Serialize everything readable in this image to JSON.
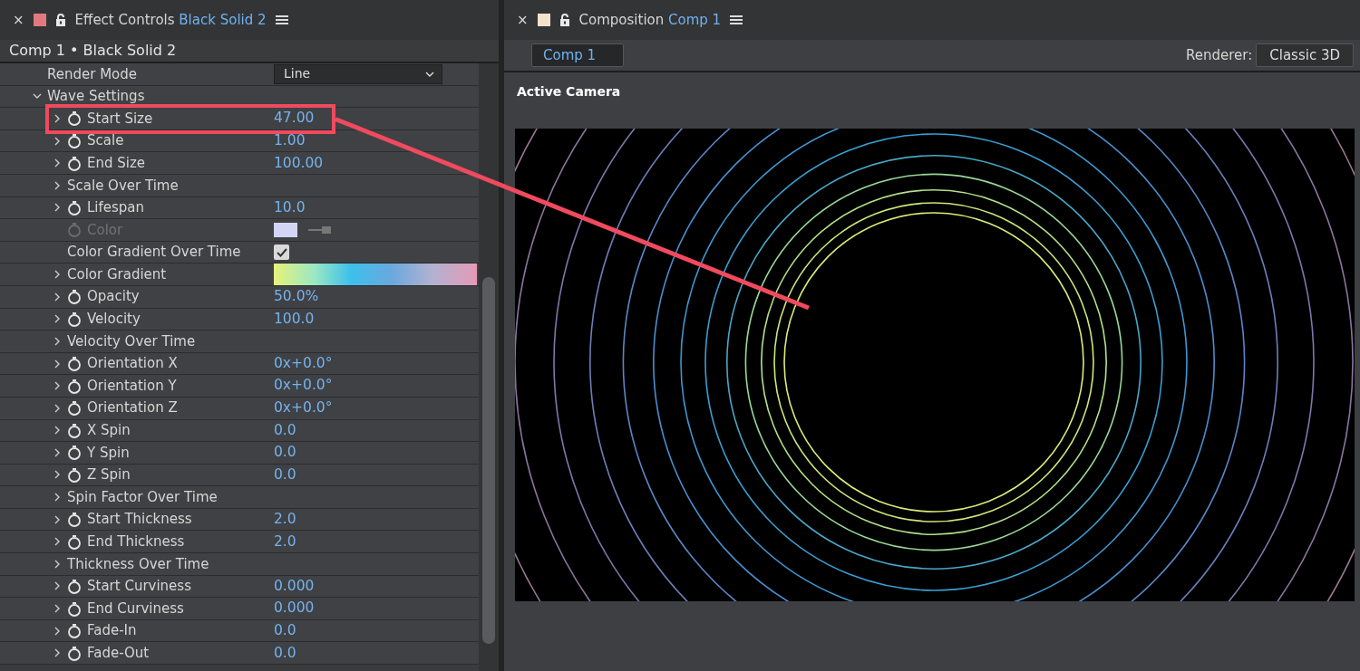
{
  "effect_panel": {
    "close": "×",
    "title": "Effect Controls",
    "layer": "Black Solid 2",
    "breadcrumb": "Comp 1 • Black Solid 2",
    "properties": [
      {
        "kind": "dropdown",
        "label": "Render Mode",
        "value": "Line"
      },
      {
        "kind": "group",
        "label": "Wave Settings",
        "expanded": true,
        "children": [
          {
            "kind": "param",
            "label": "Start Size",
            "value": "47.00",
            "stopwatch": true,
            "highlighted": true
          },
          {
            "kind": "param",
            "label": "Scale",
            "value": "1.00",
            "stopwatch": true
          },
          {
            "kind": "param",
            "label": "End Size",
            "value": "100.00",
            "stopwatch": true
          },
          {
            "kind": "group",
            "label": "Scale Over Time",
            "expanded": false
          },
          {
            "kind": "param",
            "label": "Lifespan",
            "value": "10.0",
            "stopwatch": true
          },
          {
            "kind": "color",
            "label": "Color",
            "color": "#d4d4f4",
            "disabled": true,
            "stopwatch": true
          },
          {
            "kind": "checkbox",
            "label": "Color Gradient Over Time",
            "checked": true
          },
          {
            "kind": "gradient",
            "label": "Color Gradient",
            "expanded": false
          },
          {
            "kind": "param",
            "label": "Opacity",
            "value": "50.0",
            "unit": "%",
            "stopwatch": true
          },
          {
            "kind": "param",
            "label": "Velocity",
            "value": "100.0",
            "stopwatch": true
          },
          {
            "kind": "group",
            "label": "Velocity Over Time",
            "expanded": false
          },
          {
            "kind": "param",
            "label": "Orientation X",
            "value": "0x+0.0",
            "unit": "°",
            "stopwatch": true
          },
          {
            "kind": "param",
            "label": "Orientation Y",
            "value": "0x+0.0",
            "unit": "°",
            "stopwatch": true
          },
          {
            "kind": "param",
            "label": "Orientation Z",
            "value": "0x+0.0",
            "unit": "°",
            "stopwatch": true
          },
          {
            "kind": "param",
            "label": "X Spin",
            "value": "0.0",
            "stopwatch": true
          },
          {
            "kind": "param",
            "label": "Y Spin",
            "value": "0.0",
            "stopwatch": true
          },
          {
            "kind": "param",
            "label": "Z Spin",
            "value": "0.0",
            "stopwatch": true
          },
          {
            "kind": "group",
            "label": "Spin Factor Over Time",
            "expanded": false
          },
          {
            "kind": "param",
            "label": "Start Thickness",
            "value": "2.0",
            "stopwatch": true
          },
          {
            "kind": "param",
            "label": "End Thickness",
            "value": "2.0",
            "stopwatch": true
          },
          {
            "kind": "group",
            "label": "Thickness Over Time",
            "expanded": false
          },
          {
            "kind": "param",
            "label": "Start Curviness",
            "value": "0.000",
            "stopwatch": true
          },
          {
            "kind": "param",
            "label": "End Curviness",
            "value": "0.000",
            "stopwatch": true
          },
          {
            "kind": "param",
            "label": "Fade-In",
            "value": "0.0",
            "stopwatch": true
          },
          {
            "kind": "param",
            "label": "Fade-Out",
            "value": "0.0",
            "stopwatch": true
          }
        ]
      }
    ]
  },
  "composition_panel": {
    "close": "×",
    "title": "Composition",
    "comp": "Comp 1",
    "tab": "Comp 1",
    "renderer_label": "Renderer:",
    "renderer": "Classic 3D",
    "view_label": "Active Camera"
  }
}
